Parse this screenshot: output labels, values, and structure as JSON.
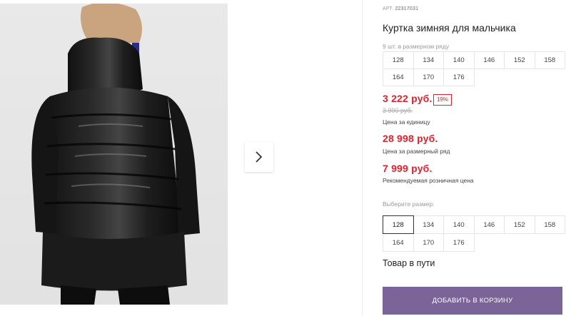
{
  "product": {
    "article_label": "АРТ.",
    "article_number": "22317031",
    "title": "Куртка зимняя для мальчика",
    "qty_note": "9 шт. в размерном ряду"
  },
  "sizes_info": [
    "128",
    "134",
    "140",
    "146",
    "152",
    "158",
    "164",
    "170",
    "176"
  ],
  "pricing": {
    "unit_price": "3 222 руб.",
    "discount_badge": "19%",
    "old_price": "3 990 руб.",
    "unit_caption": "Цена за единицу",
    "size_run_price": "28 998 руб.",
    "size_run_caption": "Цена за размерный ряд",
    "retail_price": "7 999 руб.",
    "retail_caption": "Рекомендуемая розничная цена"
  },
  "size_selector": {
    "label": "Выберите размер:",
    "options": [
      "128",
      "134",
      "140",
      "146",
      "152",
      "158",
      "164",
      "170",
      "176"
    ],
    "selected": "128"
  },
  "availability": "Товар в пути",
  "actions": {
    "add_to_cart": "ДОБАВИТЬ В КОРЗИНУ"
  },
  "colors": {
    "price_red": "#e2232f",
    "button_purple": "#7a6498",
    "jacket_black": "#1a1a1a"
  },
  "icons": {
    "next": "chevron-right-icon"
  }
}
